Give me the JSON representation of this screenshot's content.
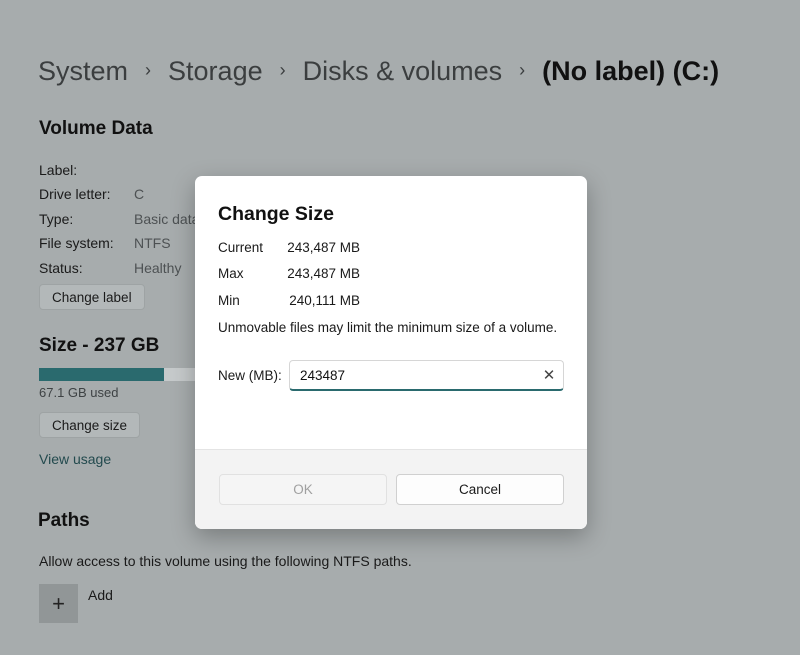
{
  "breadcrumb": {
    "items": [
      "System",
      "Storage",
      "Disks & volumes"
    ],
    "current": "(No label) (C:)",
    "separator": "›"
  },
  "volume_data": {
    "title": "Volume Data",
    "fields": [
      {
        "label": "Label:",
        "value": ""
      },
      {
        "label": "Drive letter:",
        "value": "C"
      },
      {
        "label": "Type:",
        "value": "Basic data"
      },
      {
        "label": "File system:",
        "value": "NTFS"
      },
      {
        "label": "Status:",
        "value": "Healthy"
      }
    ],
    "change_label_button": "Change label"
  },
  "size": {
    "title": "Size - 237 GB",
    "used_text": "67.1 GB used",
    "used_fraction": 0.78,
    "change_size_button": "Change size",
    "view_usage_link": "View usage"
  },
  "paths": {
    "title": "Paths",
    "description": "Allow access to this volume using the following NTFS paths.",
    "add_label": "Add",
    "add_icon": "+"
  },
  "dialog": {
    "title": "Change Size",
    "rows": [
      {
        "label": "Current",
        "value": "243,487 MB"
      },
      {
        "label": "Max",
        "value": "243,487 MB"
      },
      {
        "label": "Min",
        "value": "240,111 MB"
      }
    ],
    "note": "Unmovable files may limit the minimum size of a volume.",
    "input_label": "New (MB):",
    "input_value": "243487",
    "clear_icon": "✕",
    "ok_label": "OK",
    "cancel_label": "Cancel"
  },
  "colors": {
    "accent": "#2a6a6e",
    "overlay_background": "#a7acad"
  }
}
